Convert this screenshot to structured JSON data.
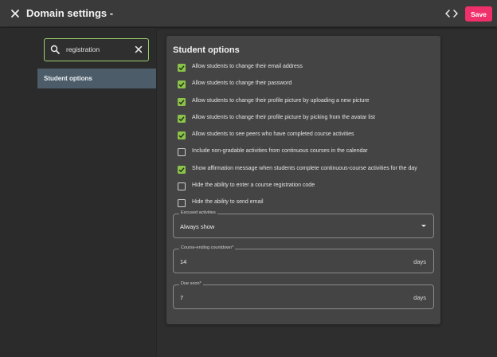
{
  "header": {
    "title": "Domain settings -",
    "save_label": "Save"
  },
  "search": {
    "value": "registration"
  },
  "nav": {
    "items": [
      {
        "label": "Student options"
      }
    ]
  },
  "card": {
    "title": "Student options",
    "options": [
      {
        "label": "Allow students to change their email address",
        "checked": true
      },
      {
        "label": "Allow students to change their password",
        "checked": true
      },
      {
        "label": "Allow students to change their profile picture by uploading a new picture",
        "checked": true
      },
      {
        "label": "Allow students to change their profile picture by picking from the avatar list",
        "checked": true
      },
      {
        "label": "Allow students to see peers who have completed course activities",
        "checked": true
      },
      {
        "label": "Include non-gradable activities from continuous courses in the calendar",
        "checked": false
      },
      {
        "label": "Show affirmation message when students complete continuous-course activities for the day",
        "checked": true
      },
      {
        "label": "Hide the ability to enter a course registration code",
        "checked": false
      },
      {
        "label": "Hide the ability to send email",
        "checked": false
      }
    ],
    "excused": {
      "label": "Excused activities",
      "value": "Always show"
    },
    "countdown": {
      "label": "Course-ending countdown*",
      "value": "14",
      "suffix": "days"
    },
    "due_soon": {
      "label": "Due soon*",
      "value": "7",
      "suffix": "days"
    }
  },
  "colors": {
    "accent": "#f0306a",
    "checkbox": "#8bc34a",
    "search_border": "#9ccf6d"
  }
}
